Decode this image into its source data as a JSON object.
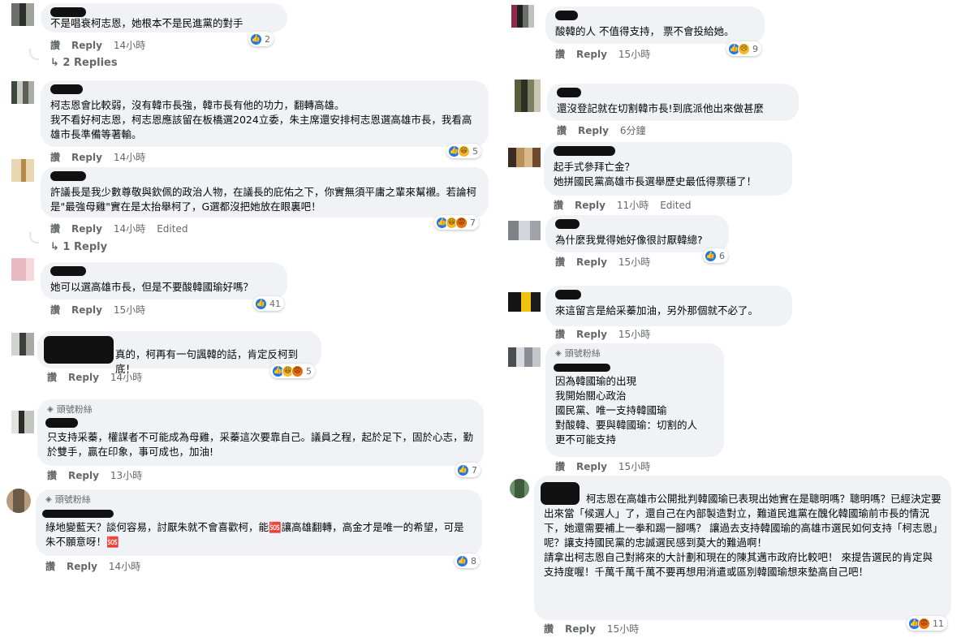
{
  "labels": {
    "like": "讚",
    "reply": "Reply",
    "edited": "Edited"
  },
  "left": [
    {
      "text": "不是唱衰柯志恩，她根本不是民進黨的對手",
      "time": "14小時",
      "reactions": [
        "like"
      ],
      "count": "2",
      "replies": "2 Replies"
    },
    {
      "text": "柯志恩會比較弱，沒有韓市長強，韓市長有他的功力，翻轉高雄。\n我不看好柯志恩，柯志恩應該留在板橋選2024立委，朱主席還安排柯志恩選高雄市長，我看高雄市長準備等著輸。",
      "time": "14小時",
      "reactions": [
        "like",
        "haha"
      ],
      "count": "5"
    },
    {
      "text": "許議長是我少數尊敬與欽佩的政治人物，在議長的庇佑之下，你實無須平庸之輩來幫襯。若論柯是\"最強母雞\"實在是太抬舉柯了，G選都沒把她放在眼裏吧！",
      "time": "14小時",
      "edited": "Edited",
      "reactions": [
        "like",
        "haha",
        "angry"
      ],
      "count": "7",
      "replies": "1 Reply"
    },
    {
      "text": "她可以選高雄市長，但是不要酸韓國瑜好嗎？",
      "time": "15小時",
      "reactions": [
        "like"
      ],
      "count": "41"
    },
    {
      "text": "真的，柯再有一句諷韓的話，肯定反柯到底！",
      "time": "14小時",
      "reactions": [
        "like",
        "haha",
        "angry"
      ],
      "count": "5"
    },
    {
      "badge": "頭號粉絲",
      "text": "只支持采蓁，權謀者不可能成為母雞，采蓁這次要靠自己。議員之程，起於足下，固於心志，勤於雙手，贏在印象，事可成也，加油!",
      "time": "13小時",
      "reactions": [
        "like"
      ],
      "count": "7"
    },
    {
      "badge": "頭號粉絲",
      "text": "綠地變藍天？談何容易，討厭朱就不會喜歡柯，能🆘讓高雄翻轉，高金才是唯一的希望，可是朱不願意呀！🆘",
      "time": "14小時",
      "reactions": [
        "like"
      ],
      "count": "8"
    }
  ],
  "right": [
    {
      "text": "酸韓的人 不值得支持， 票不會投給她。",
      "time": "15小時",
      "reactions": [
        "like",
        "sad"
      ],
      "count": "9"
    },
    {
      "text": "還沒登記就在切割韓市長!到底派他出來做甚麼",
      "time": "6分鐘"
    },
    {
      "text": "起手式參拜亡金？\n她拼國民黨高雄市長選舉歷史最低得票穩了！",
      "time": "11小時",
      "edited": "Edited"
    },
    {
      "text": "為什麼我覺得她好像很討厭韓總?",
      "time": "15小時",
      "reactions": [
        "like"
      ],
      "count": "6"
    },
    {
      "text": "來這留言是給采蓁加油，另外那個就不必了。",
      "time": "15小時"
    },
    {
      "badge": "頭號粉絲",
      "text": "因為韓國瑜的出現\n我開始關心政治\n國民黨、唯一支持韓國瑜\n對酸韓、要與韓國瑜：切割的人\n更不可能支持",
      "time": "15小時"
    },
    {
      "text": "柯志恩在高雄市公開批判韓國瑜已表現出她實在是聰明嗎？聰明嗎？已經決定要出來當「候選人」了，還自己在內部製造對立，難道民進黨在醜化韓國瑜前市長的情況下，她還需要補上一拳和踢一腳嗎？ 讓過去支持韓國瑜的高雄市選民如何支持「柯志恩」呢？讓支持國民黨的忠誠選民感到莫大的難過啊！\n請拿出柯志恩自己對將來的大計劃和現在的陳其邁市政府比較吧！ 來提告選民的肯定與支持度喔！千萬千萬千萬不要再想用消遣或區別韓國瑜想來墊高自己吧！",
      "time": "15小時",
      "reactions": [
        "like",
        "angry"
      ],
      "count": "11"
    }
  ]
}
